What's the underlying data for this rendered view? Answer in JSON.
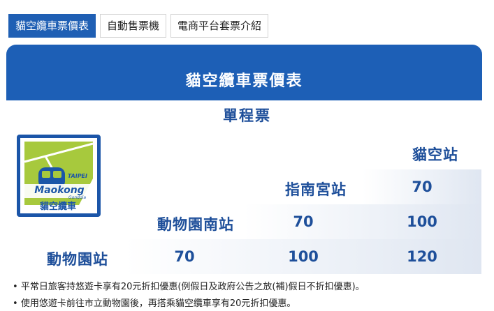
{
  "tabs": [
    {
      "label": "貓空纜車票價表",
      "active": true
    },
    {
      "label": "自動售票機",
      "active": false
    },
    {
      "label": "電商平台套票介紹",
      "active": false
    }
  ],
  "banner": {
    "title": "貓空纜車票價表"
  },
  "section": {
    "subtitle": "單程票"
  },
  "logo": {
    "text_top": "TAIPEI",
    "text_main": "Maokong",
    "text_sub": "Gondola",
    "text_cn": "貓空纜車"
  },
  "stations": {
    "maokong": "貓空站",
    "zhinan": "指南宮站",
    "zoo_south": "動物園南站",
    "zoo": "動物園站"
  },
  "fares": {
    "zhinan_maokong": "70",
    "zoo_south_zhinan": "70",
    "zoo_south_maokong": "100",
    "zoo_zoo_south": "70",
    "zoo_zhinan": "100",
    "zoo_maokong": "120"
  },
  "notes": [
    "平常日旅客持悠遊卡享有20元折扣優惠(例假日及政府公告之放(補)假日不折扣優惠)。",
    "使用悠遊卡前往市立動物園後，再搭乘貓空纜車享有20元折扣優惠。"
  ],
  "colors": {
    "primary": "#1d5fb6",
    "text": "#1e4f9a",
    "logo_green": "#a7c93d"
  }
}
